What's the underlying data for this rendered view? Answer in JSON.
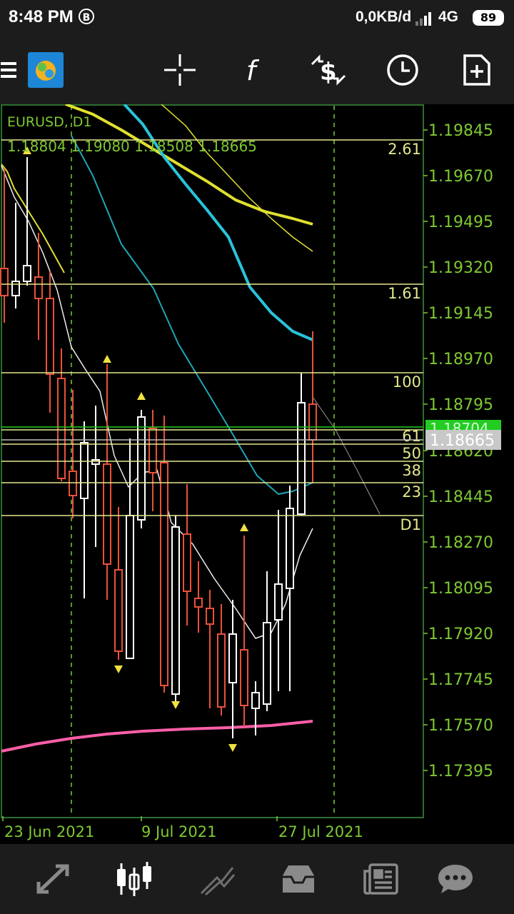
{
  "status_bar": {
    "time": "8:48 PM",
    "b_badge": "B",
    "net_speed": "0,0KB/d",
    "network_type": "4G",
    "battery": "89"
  },
  "toolbar": {
    "icons": [
      "menu-icon",
      "metatrader-logo-icon",
      "crosshair-icon",
      "indicators-icon",
      "trade-icon",
      "timeframe-clock-icon",
      "add-object-icon"
    ]
  },
  "chart": {
    "symbol_label": "EURUSD, D1",
    "ohlc_label": "1.18804 1.19080 1.18508 1.18665",
    "price_ticks": [
      "1.19845",
      "1.19670",
      "1.19495",
      "1.19320",
      "1.19145",
      "1.18970",
      "1.18795",
      "1.18620",
      "1.18445",
      "1.18270",
      "1.18095",
      "1.17920",
      "1.17745",
      "1.17570",
      "1.17395"
    ],
    "ask_tag": "1.18704",
    "bid_tag": "1.18665",
    "date_labels": [
      "23 Jun 2021",
      "9 Jul 2021",
      "27 Jul 2021"
    ],
    "fib_levels": [
      "2.61",
      "1.61",
      "100",
      "61",
      "50",
      "38",
      "23",
      "D1"
    ],
    "colors": {
      "bull": "#ffffff",
      "bear": "#e8513a",
      "tick_text": "#7ec832",
      "fib_line": "#e4e88c",
      "ma_cyan": "#29c3dc",
      "ma_yellow": "#e0e030",
      "ma_pink": "#ff5fa8",
      "ask": "#22cc22",
      "bid": "#c8c8c8"
    }
  },
  "bottom_nav": {
    "items": [
      "quotes-icon",
      "chart-icon",
      "trade-icon",
      "history-icon",
      "news-icon",
      "chat-icon"
    ]
  }
}
